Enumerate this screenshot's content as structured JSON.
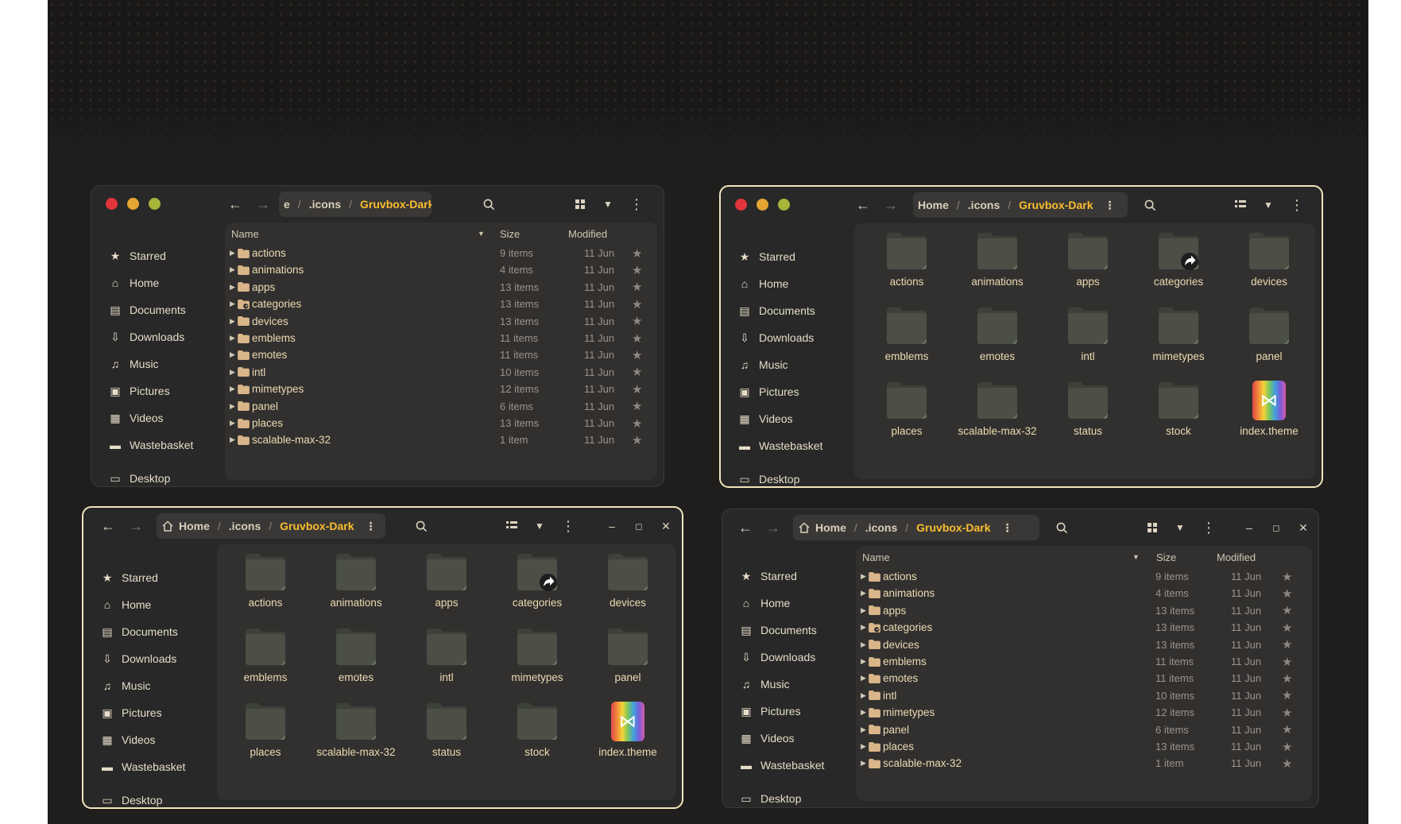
{
  "colors": {
    "accent": "#fabd2f",
    "folder_list": "#d9b58a",
    "folder_grid": "#4b4f45",
    "close": "#e0353a",
    "minimize": "#e5a532",
    "maximize": "#a7b43a"
  },
  "icons": {
    "back": "arrow-left-icon",
    "forward": "arrow-right-icon",
    "search": "search-icon",
    "menu": "kebab-menu-icon",
    "grid": "grid-view-icon",
    "list": "list-view-icon",
    "dropdown": "chevron-down-icon",
    "star": "star-icon",
    "home": "home-icon"
  },
  "sidebar": {
    "items": [
      {
        "label": "Starred",
        "icon": "star-icon"
      },
      {
        "label": "Home",
        "icon": "home-icon"
      },
      {
        "label": "Documents",
        "icon": "document-icon"
      },
      {
        "label": "Downloads",
        "icon": "download-icon"
      },
      {
        "label": "Music",
        "icon": "music-icon"
      },
      {
        "label": "Pictures",
        "icon": "picture-icon"
      },
      {
        "label": "Videos",
        "icon": "film-icon"
      },
      {
        "label": "Wastebasket",
        "icon": "trash-icon"
      },
      {
        "label": "Desktop",
        "icon": "desktop-icon"
      }
    ]
  },
  "path": {
    "truncated": [
      "e",
      ".icons",
      "Gruvbox-Dark"
    ],
    "full": [
      "Home",
      ".icons",
      "Gruvbox-Dark"
    ]
  },
  "list_columns": {
    "name": "Name",
    "size": "Size",
    "modified": "Modified"
  },
  "list_rows": [
    {
      "name": "actions",
      "size": "9 items",
      "modified": "11 Jun"
    },
    {
      "name": "animations",
      "size": "4 items",
      "modified": "11 Jun"
    },
    {
      "name": "apps",
      "size": "13 items",
      "modified": "11 Jun"
    },
    {
      "name": "categories",
      "size": "13 items",
      "modified": "11 Jun"
    },
    {
      "name": "devices",
      "size": "13 items",
      "modified": "11 Jun"
    },
    {
      "name": "emblems",
      "size": "11 items",
      "modified": "11 Jun"
    },
    {
      "name": "emotes",
      "size": "11 items",
      "modified": "11 Jun"
    },
    {
      "name": "intl",
      "size": "10 items",
      "modified": "11 Jun"
    },
    {
      "name": "mimetypes",
      "size": "12 items",
      "modified": "11 Jun"
    },
    {
      "name": "panel",
      "size": "6 items",
      "modified": "11 Jun"
    },
    {
      "name": "places",
      "size": "13 items",
      "modified": "11 Jun"
    },
    {
      "name": "scalable-max-32",
      "size": "1 item",
      "modified": "11 Jun"
    }
  ],
  "grid_items": [
    {
      "label": "actions",
      "kind": "folder"
    },
    {
      "label": "animations",
      "kind": "folder"
    },
    {
      "label": "apps",
      "kind": "folder"
    },
    {
      "label": "categories",
      "kind": "folder-link"
    },
    {
      "label": "devices",
      "kind": "folder"
    },
    {
      "label": "emblems",
      "kind": "folder"
    },
    {
      "label": "emotes",
      "kind": "folder"
    },
    {
      "label": "intl",
      "kind": "folder"
    },
    {
      "label": "mimetypes",
      "kind": "folder"
    },
    {
      "label": "panel",
      "kind": "folder"
    },
    {
      "label": "places",
      "kind": "folder"
    },
    {
      "label": "scalable-max-32",
      "kind": "folder"
    },
    {
      "label": "status",
      "kind": "folder"
    },
    {
      "label": "stock",
      "kind": "folder"
    },
    {
      "label": "index.theme",
      "kind": "theme-file"
    }
  ]
}
